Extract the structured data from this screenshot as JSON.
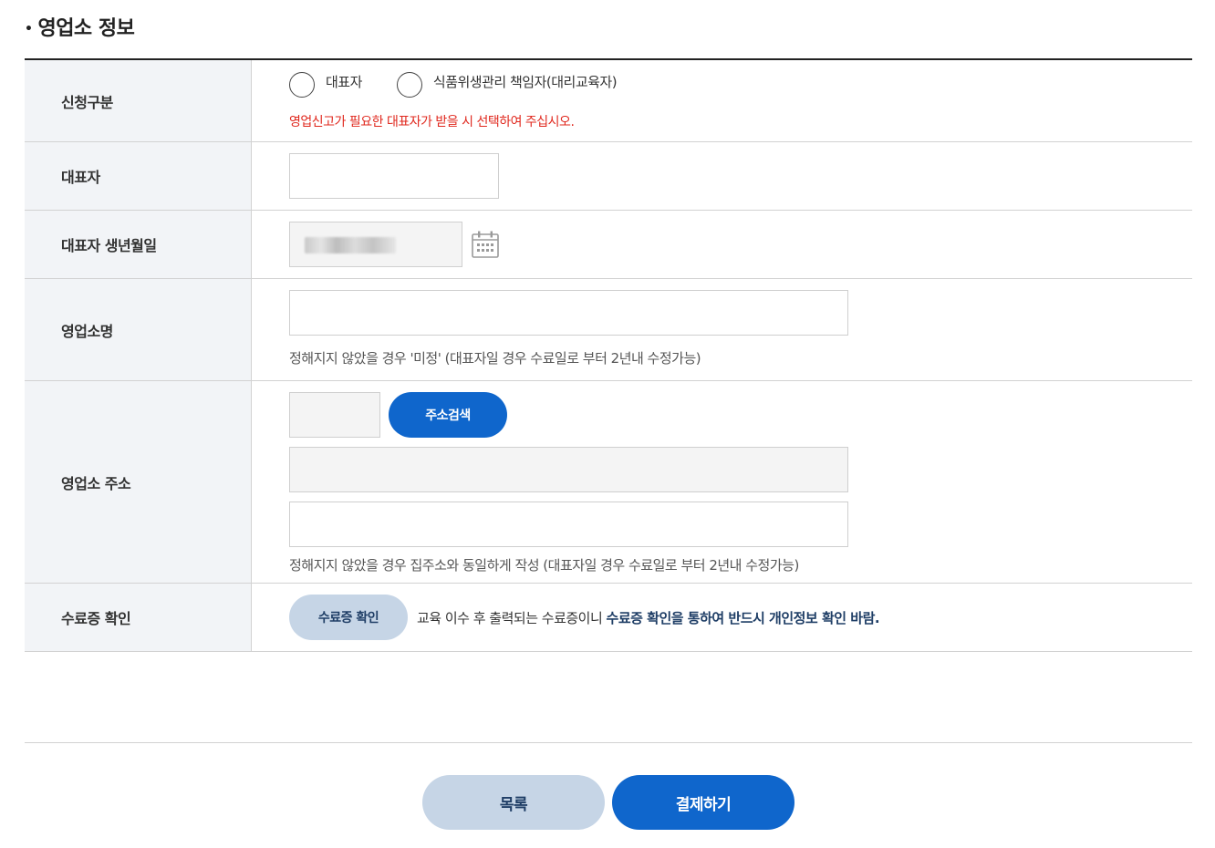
{
  "section": {
    "title": "영업소 정보"
  },
  "form": {
    "apply_type": {
      "label": "신청구분",
      "options": [
        "대표자",
        "식품위생관리 책임자(대리교육자)"
      ],
      "notice": "영업신고가 필요한 대표자가 받을 시 선택하여 주십시오."
    },
    "representative": {
      "label": "대표자",
      "value": ""
    },
    "birthdate": {
      "label": "대표자 생년월일",
      "icon": "calendar-icon"
    },
    "shop_name": {
      "label": "영업소명",
      "value": "",
      "hint": "정해지지 않았을 경우 '미정' (대표자일 경우 수료일로 부터 2년내 수정가능)"
    },
    "address": {
      "label": "영업소 주소",
      "zip_value": "",
      "search_button": "주소검색",
      "address1_value": "",
      "address2_value": "",
      "hint": "정해지지 않았을 경우 집주소와 동일하게 작성 (대표자일 경우 수료일로 부터 2년내 수정가능)"
    },
    "certificate": {
      "label": "수료증 확인",
      "button": "수료증 확인",
      "text_plain": "교육 이수 후 출력되는 수료증이니 ",
      "text_strong": "수료증 확인을 통하여 반드시 개인정보 확인 바람."
    }
  },
  "footer": {
    "list_button": "목록",
    "pay_button": "결제하기"
  },
  "colors": {
    "primary": "#0f66cc",
    "secondary": "#c6d5e6",
    "notice_red": "#e0281e",
    "label_bg": "#f2f4f7",
    "strong_text": "#1f3e66"
  }
}
